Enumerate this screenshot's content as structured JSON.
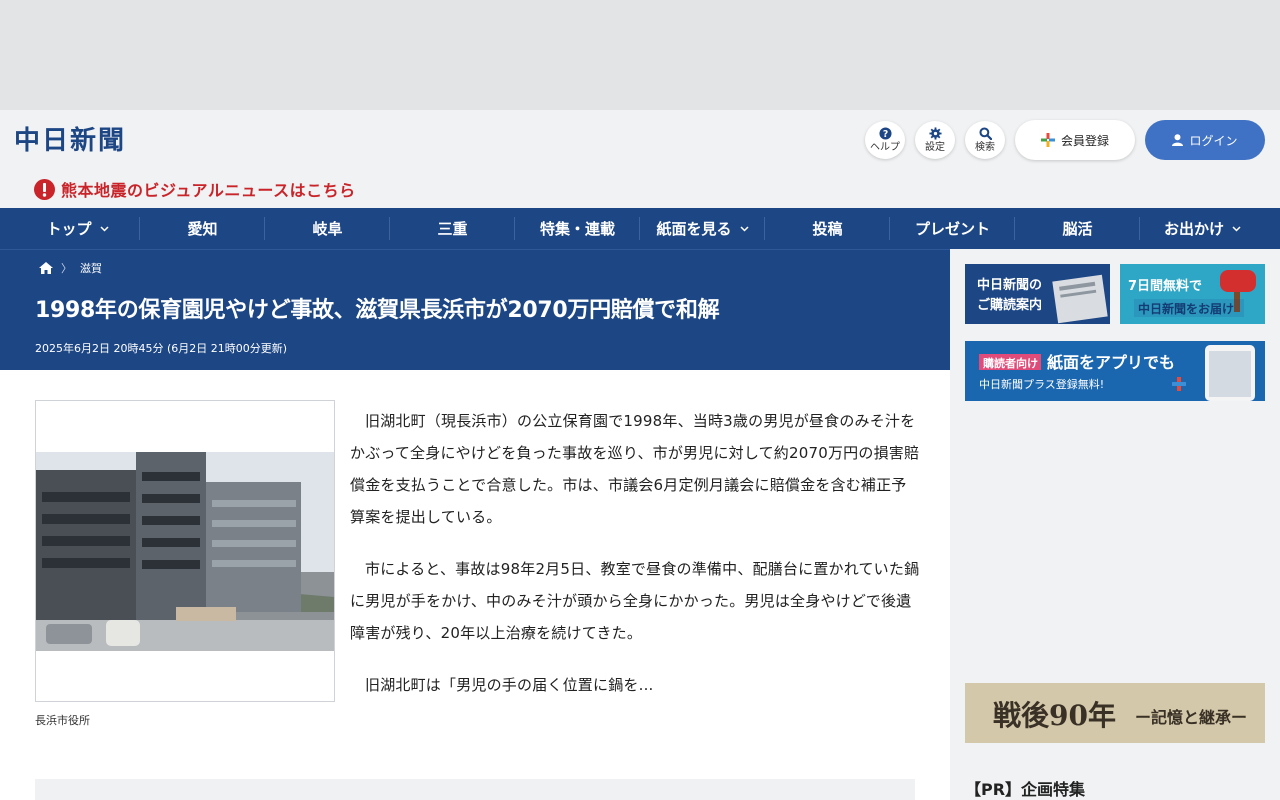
{
  "header": {
    "logo_text": "中日新聞",
    "help_label": "ヘルプ",
    "settings_label": "設定",
    "search_label": "検索",
    "member_label": "会員登録",
    "login_label": "ログイン"
  },
  "alert": {
    "text": "熊本地震のビジュアルニュースはこちら"
  },
  "nav": {
    "items": [
      {
        "label": "トップ",
        "has_dropdown": true
      },
      {
        "label": "愛知",
        "has_dropdown": false
      },
      {
        "label": "岐阜",
        "has_dropdown": false
      },
      {
        "label": "三重",
        "has_dropdown": false
      },
      {
        "label": "特集・連載",
        "has_dropdown": false
      },
      {
        "label": "紙面を見る",
        "has_dropdown": true
      },
      {
        "label": "投稿",
        "has_dropdown": false
      },
      {
        "label": "プレゼント",
        "has_dropdown": false
      },
      {
        "label": "脳活",
        "has_dropdown": false
      },
      {
        "label": "お出かけ",
        "has_dropdown": true
      }
    ]
  },
  "breadcrumb": {
    "category": "滋賀"
  },
  "article": {
    "title": "1998年の保育園児やけど事故、滋賀県長浜市が2070万円賠償で和解",
    "date": "2025年6月2日 20時45分 (6月2日 21時00分更新)",
    "photo_caption": "長浜市役所",
    "paragraphs": [
      "旧湖北町（現長浜市）の公立保育園で1998年、当時3歳の男児が昼食のみそ汁をかぶって全身にやけどを負った事故を巡り、市が男児に対して約2070万円の損害賠償金を支払うことで合意した。市は、市議会6月定例月議会に賠償金を含む補正予算案を提出している。",
      "市によると、事故は98年2月5日、教室で昼食の準備中、配膳台に置かれていた鍋に男児が手をかけ、中のみそ汁が頭から全身にかかった。男児は全身やけどで後遺障害が残り、20年以上治療を続けてきた。",
      "旧湖北町は「男児の手の届く位置に鍋を..."
    ]
  },
  "sidebar": {
    "banner1_line1": "中日新聞の",
    "banner1_line2": "ご購読案内",
    "banner2_line1": "7日間無料で",
    "banner2_line2": "中日新聞をお届け",
    "banner3_tag": "購読者向け",
    "banner3_line1": "紙面をアプリでも",
    "banner3_line2": "中日新聞プラス登録無料!",
    "banner4_text": "戦後90年",
    "banner4_sub": "ー記憶と継承ー",
    "pr_title": "【PR】企画特集"
  },
  "colors": {
    "navy": "#1d4685",
    "login_blue": "#3f72c4",
    "alert_red": "#c9242a",
    "gray_bg": "#f1f2f3"
  }
}
